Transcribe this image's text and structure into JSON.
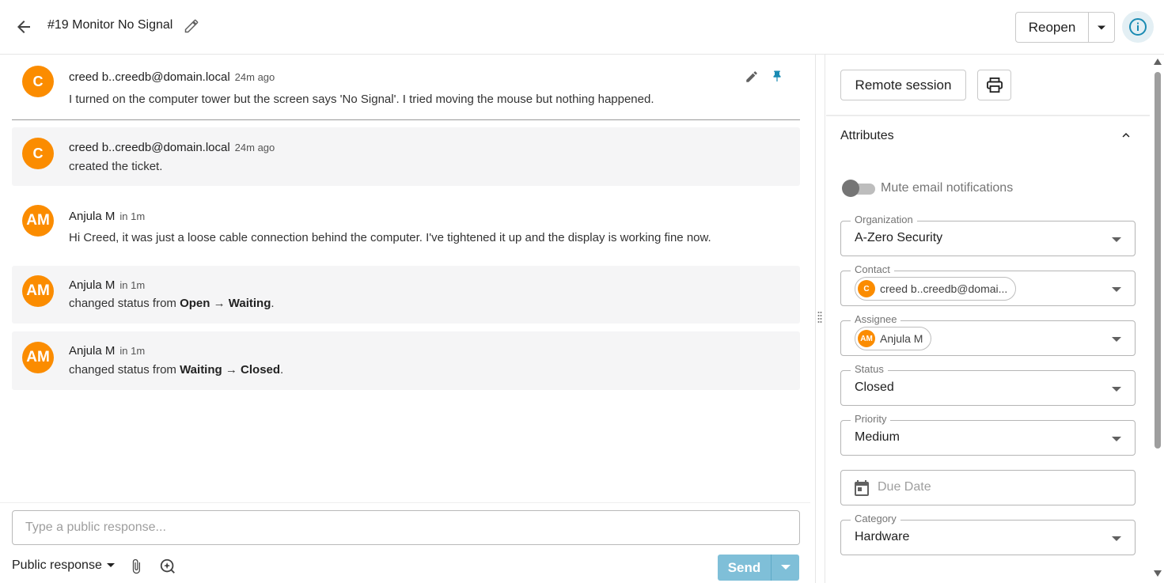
{
  "header": {
    "title": "#19 Monitor No Signal",
    "reopen_label": "Reopen"
  },
  "messages": [
    {
      "avatar": "C",
      "author": "creed b..creedb@domain.local",
      "time": "24m ago",
      "text": "I turned on the computer tower but the screen says 'No Signal'. I tried moving the mouse but nothing happened."
    },
    {
      "avatar": "C",
      "author": "creed b..creedb@domain.local",
      "time": "24m ago",
      "text": "created the ticket."
    },
    {
      "avatar": "AM",
      "author": "Anjula M",
      "time": "in 1m",
      "text": "Hi Creed, it was just a loose cable connection behind the computer. I've tightened it up and the display is working fine now."
    },
    {
      "avatar": "AM",
      "author": "Anjula M",
      "time": "in 1m",
      "prefix": "changed status from ",
      "from": "Open",
      "arrow": " → ",
      "to": "Waiting",
      "suffix": "."
    },
    {
      "avatar": "AM",
      "author": "Anjula M",
      "time": "in 1m",
      "prefix": "changed status from ",
      "from": "Waiting",
      "arrow": " → ",
      "to": "Closed",
      "suffix": "."
    }
  ],
  "composer": {
    "placeholder": "Type a public response...",
    "response_type": "Public response",
    "send_label": "Send"
  },
  "sidebar": {
    "remote_session_label": "Remote session",
    "attributes_title": "Attributes",
    "mute_label": "Mute email notifications",
    "mute_enabled": false,
    "fields": {
      "organization": {
        "label": "Organization",
        "value": "A-Zero Security"
      },
      "contact": {
        "label": "Contact",
        "chip_avatar": "C",
        "value": "creed b..creedb@domai..."
      },
      "assignee": {
        "label": "Assignee",
        "chip_avatar": "AM",
        "value": "Anjula M"
      },
      "status": {
        "label": "Status",
        "value": "Closed"
      },
      "priority": {
        "label": "Priority",
        "value": "Medium"
      },
      "due_date": {
        "placeholder": "Due Date"
      },
      "category": {
        "label": "Category",
        "value": "Hardware"
      }
    }
  },
  "colors": {
    "avatar": "#fb8c00",
    "accent": "#1a8bb3",
    "send_disabled": "#7fbfd8",
    "message_bg": "#f5f5f6"
  }
}
